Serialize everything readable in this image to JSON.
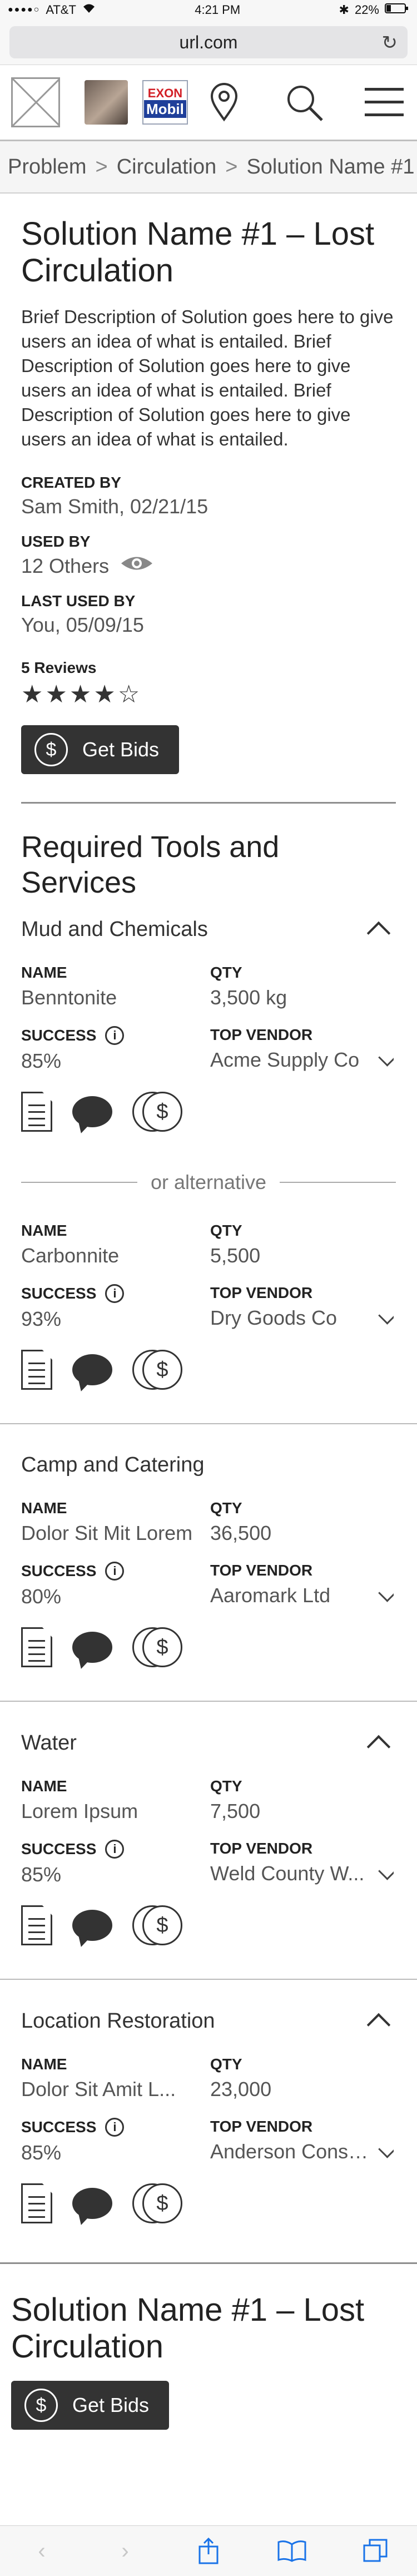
{
  "status": {
    "carrier": "AT&T",
    "time": "4:21 PM",
    "battery": "22%"
  },
  "browser": {
    "url": "url.com"
  },
  "header": {
    "brand_top": "EXON",
    "brand_bottom": "Mobil"
  },
  "breadcrumb": [
    "Problem",
    "Circulation",
    "Solution Name #1"
  ],
  "solution": {
    "title": "Solution Name #1 – Lost Circulation",
    "description": "Brief Description of Solution goes here to give users an idea of what is entailed. Brief Description of Solution goes here to give users an idea of what is entailed. Brief Description of Solution goes here to give users an idea of what is entailed.",
    "created_by_label": "CREATED BY",
    "created_by": "Sam Smith, 02/21/15",
    "used_by_label": "USED BY",
    "used_by": "12 Others",
    "last_used_label": "LAST USED BY",
    "last_used": "You, 05/09/15",
    "reviews_label": "5 Reviews",
    "rating": 4,
    "rating_max": 5,
    "get_bids": "Get Bids"
  },
  "tools": {
    "heading": "Required Tools and Services",
    "labels": {
      "name": "NAME",
      "qty": "QTY",
      "success": "SUCCESS",
      "vendor": "TOP VENDOR"
    },
    "or_alternative": "or alternative",
    "groups": [
      {
        "title": "Mud and Chemicals",
        "items": [
          {
            "name": "Benntonite",
            "qty": "3,500 kg",
            "success": "85%",
            "vendor": "Acme Supply Co"
          },
          {
            "name": "Carbonnite",
            "qty": "5,500",
            "success": "93%",
            "vendor": "Dry Goods Co"
          }
        ]
      },
      {
        "title": "Camp and Catering",
        "items": [
          {
            "name": "Dolor Sit Mit Lorem",
            "qty": "36,500",
            "success": "80%",
            "vendor": "Aaromark Ltd"
          }
        ]
      },
      {
        "title": "Water",
        "items": [
          {
            "name": "Lorem Ipsum",
            "qty": "7,500",
            "success": "85%",
            "vendor": "Weld County W..."
          }
        ]
      },
      {
        "title": "Location Restoration",
        "items": [
          {
            "name": "Dolor Sit Amit L...",
            "qty": "23,000",
            "success": "85%",
            "vendor": "Anderson Consu..."
          }
        ]
      }
    ]
  },
  "footer": {
    "title": "Solution Name #1 – Lost Circulation",
    "get_bids": "Get Bids"
  }
}
